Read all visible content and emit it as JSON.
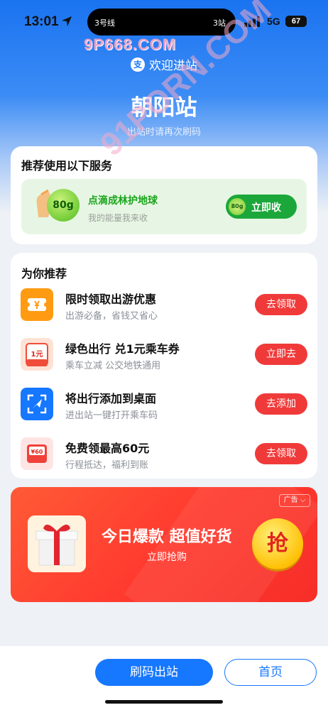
{
  "status_bar": {
    "time": "13:01",
    "island_left": "3号线",
    "island_right": "3站",
    "network": "5G",
    "battery": "67"
  },
  "watermark": {
    "top": "9P668.COM",
    "diagonal": "91PORN.COM"
  },
  "header": {
    "welcome": "欢迎进站",
    "alipay_glyph": "支",
    "station": "朝阳站",
    "hint": "出站时请再次刷码"
  },
  "service_card": {
    "title": "推荐使用以下服务",
    "eco_title": "点滴成林护地球",
    "eco_sub": "我的能量我来收",
    "energy_badge": "80g",
    "button_badge": "80g",
    "button_label": "立即收"
  },
  "recommend": {
    "title": "为你推荐",
    "items": [
      {
        "title": "限时领取出游优惠",
        "subtitle": "出游必备，省钱又省心",
        "button": "去领取"
      },
      {
        "title": "绿色出行 兑1元乘车券",
        "subtitle": "乘车立减 公交地铁通用",
        "button": "立即去",
        "icon_text": "1元"
      },
      {
        "title": "将出行添加到桌面",
        "subtitle": "进出站一键打开乘车码",
        "button": "去添加"
      },
      {
        "title": "免费领最高60元",
        "subtitle": "行程抵达，福利到账",
        "button": "去领取",
        "icon_text": "¥60"
      }
    ]
  },
  "ad": {
    "tag": "广告",
    "title": "今日爆款 超值好货",
    "subtitle": "立即抢购",
    "grab": "抢"
  },
  "bottom": {
    "primary": "刷码出站",
    "secondary": "首页"
  },
  "colors": {
    "brand_blue": "#1677ff",
    "green": "#1ba739",
    "red": "#f03a3a"
  }
}
